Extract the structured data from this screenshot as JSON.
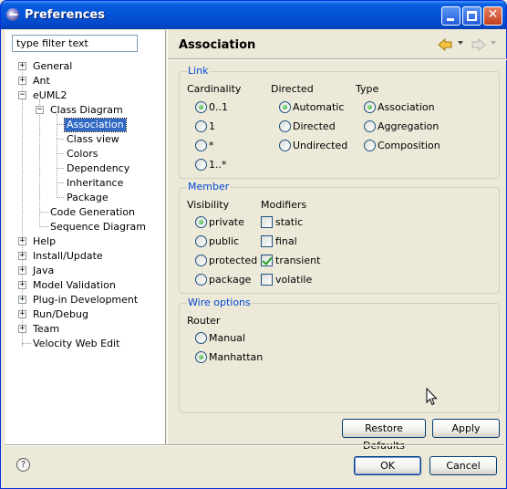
{
  "window": {
    "title": "Preferences"
  },
  "filter": {
    "placeholder": "type filter text",
    "value": "type filter text"
  },
  "tree": {
    "general": "General",
    "ant": "Ant",
    "euml2": "eUML2",
    "class_diagram": "Class Diagram",
    "association": "Association",
    "class_view": "Class view",
    "colors": "Colors",
    "dependency": "Dependency",
    "inheritance": "Inheritance",
    "package": "Package",
    "code_generation": "Code Generation",
    "sequence_diagram": "Sequence Diagram",
    "help": "Help",
    "install_update": "Install/Update",
    "java": "Java",
    "model_validation": "Model Validation",
    "plugin_development": "Plug-in Development",
    "run_debug": "Run/Debug",
    "team": "Team",
    "velocity_web_edit": "Velocity Web Edit"
  },
  "page": {
    "title": "Association"
  },
  "link": {
    "group_title": "Link",
    "cardinality": {
      "label": "Cardinality",
      "options": [
        "0..1",
        "1",
        "*",
        "1..*"
      ],
      "selected": "0..1"
    },
    "directed": {
      "label": "Directed",
      "options": [
        "Automatic",
        "Directed",
        "Undirected"
      ],
      "selected": "Automatic"
    },
    "type": {
      "label": "Type",
      "options": [
        "Association",
        "Aggregation",
        "Composition"
      ],
      "selected": "Association"
    }
  },
  "member": {
    "group_title": "Member",
    "visibility": {
      "label": "Visibility",
      "options": [
        "private",
        "public",
        "protected",
        "package"
      ],
      "selected": "private"
    },
    "modifiers": {
      "label": "Modifiers",
      "options": [
        "static",
        "final",
        "transient",
        "volatile"
      ],
      "checked": [
        "transient"
      ]
    }
  },
  "wire": {
    "group_title": "Wire options",
    "router": {
      "label": "Router",
      "options": [
        "Manual",
        "Manhattan"
      ],
      "selected": "Manhattan"
    }
  },
  "buttons": {
    "restore_defaults": "Restore Defaults",
    "apply": "Apply",
    "ok": "OK",
    "cancel": "Cancel"
  },
  "icons": {
    "nav_back": "arrow-left-icon",
    "nav_forward": "arrow-right-icon",
    "help": "help-icon"
  },
  "colors": {
    "titlebar": "#0453d8",
    "selection": "#316ac5",
    "group_title": "#0046d5",
    "window_bg": "#ece9d8"
  }
}
